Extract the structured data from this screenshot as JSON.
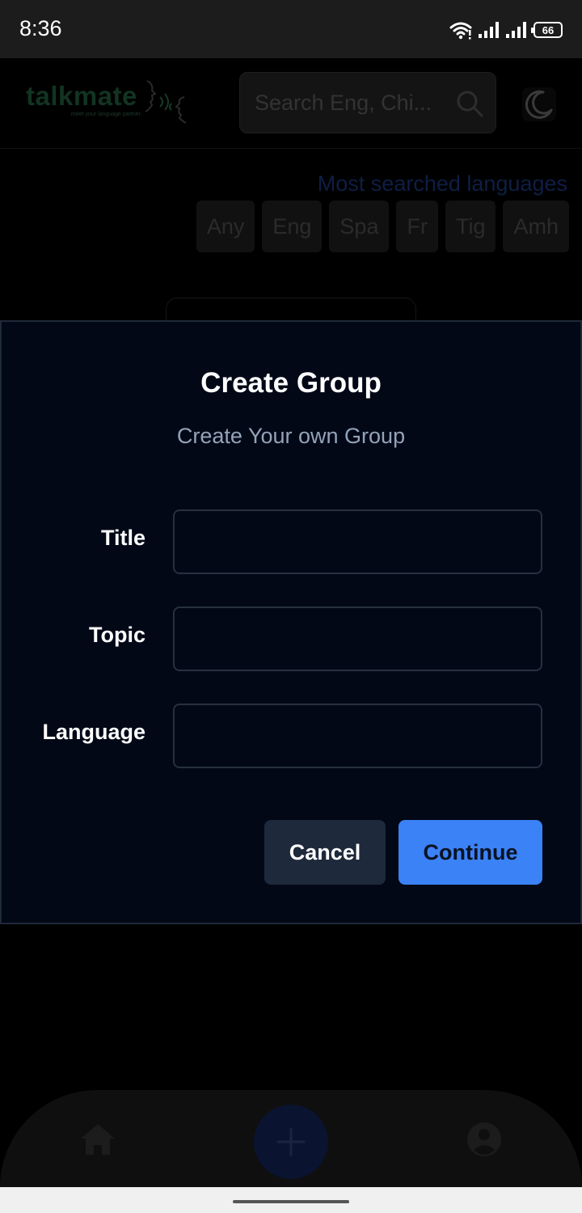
{
  "status_bar": {
    "time": "8:36",
    "battery": "66",
    "icons": [
      "wifi-icon",
      "signal-icon",
      "signal-icon",
      "battery-icon"
    ]
  },
  "header": {
    "logo_text": "talkmate",
    "logo_tagline": "meet your language partner",
    "search_placeholder": "Search Eng, Chi...",
    "theme_icon": "moon-icon"
  },
  "languages": {
    "heading": "Most searched languages",
    "chips": [
      "Any",
      "Eng",
      "Spa",
      "Fr",
      "Tig",
      "Amh"
    ]
  },
  "modal": {
    "title": "Create Group",
    "subtitle": "Create Your own Group",
    "fields": [
      {
        "label": "Title",
        "value": ""
      },
      {
        "label": "Topic",
        "value": ""
      },
      {
        "label": "Language",
        "value": ""
      }
    ],
    "cancel_label": "Cancel",
    "continue_label": "Continue"
  },
  "bottom_nav": {
    "items": [
      "home-icon",
      "add-icon",
      "profile-icon"
    ]
  },
  "colors": {
    "modal_bg": "#030817",
    "accent": "#3b82f6",
    "cancel_bg": "#1e293b",
    "subtitle": "#93a3b8"
  }
}
